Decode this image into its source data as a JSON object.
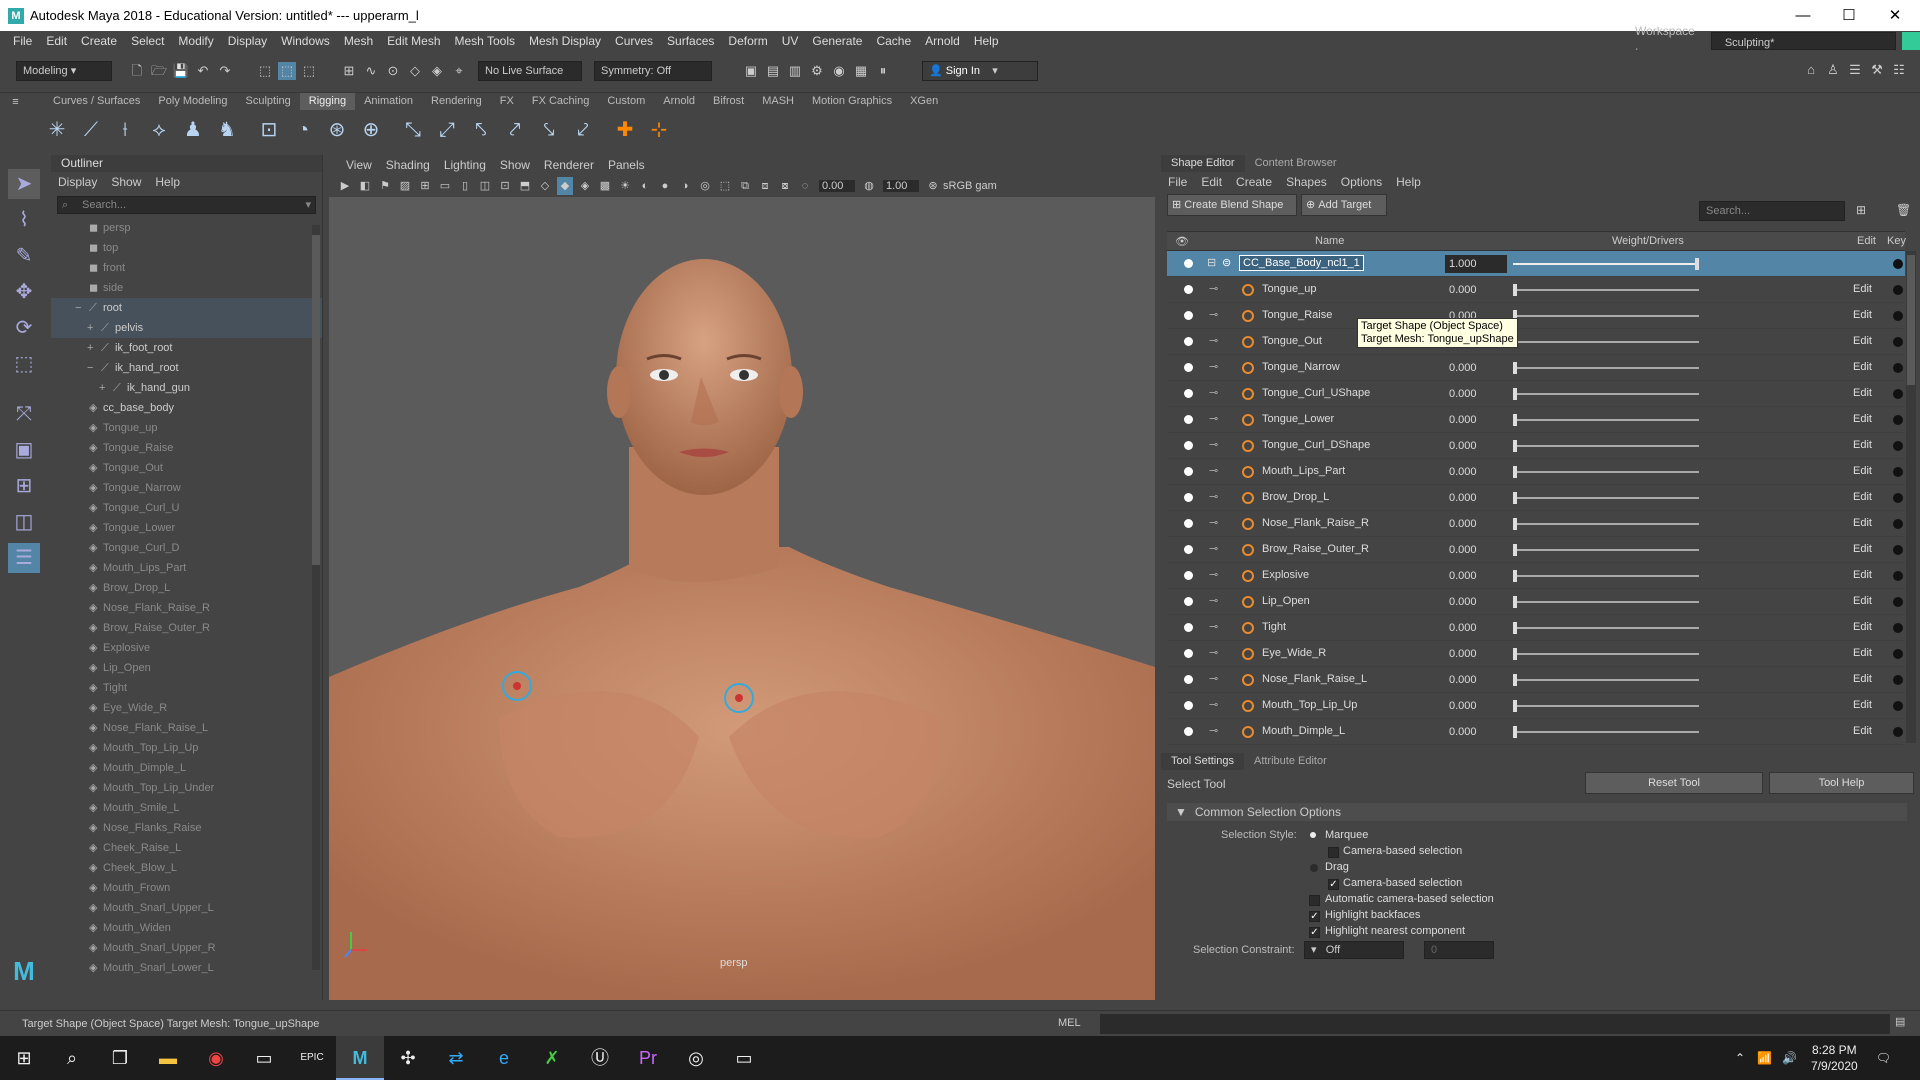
{
  "window": {
    "title": "Autodesk Maya 2018 - Educational Version: untitled*  ---  upperarm_l"
  },
  "menubar": [
    "File",
    "Edit",
    "Create",
    "Select",
    "Modify",
    "Display",
    "Windows",
    "Mesh",
    "Edit Mesh",
    "Mesh Tools",
    "Mesh Display",
    "Curves",
    "Surfaces",
    "Deform",
    "UV",
    "Generate",
    "Cache",
    "Arnold",
    "Help"
  ],
  "workspace": {
    "label": "Workspace :",
    "value": "Sculpting*"
  },
  "status": {
    "mode": "Modeling",
    "live_surface": "No Live Surface",
    "symmetry": "Symmetry: Off",
    "sign_in": "Sign In"
  },
  "shelf_tabs": [
    "Curves / Surfaces",
    "Poly Modeling",
    "Sculpting",
    "Rigging",
    "Animation",
    "Rendering",
    "FX",
    "FX Caching",
    "Custom",
    "Arnold",
    "Bifrost",
    "MASH",
    "Motion Graphics",
    "XGen"
  ],
  "shelf_active": "Rigging",
  "outliner": {
    "title": "Outliner",
    "menu": [
      "Display",
      "Show",
      "Help"
    ],
    "search_placeholder": "Search...",
    "items": [
      {
        "label": "persp",
        "indent": 1,
        "dim": true,
        "icon": "camera-icon"
      },
      {
        "label": "top",
        "indent": 1,
        "dim": true,
        "icon": "camera-icon"
      },
      {
        "label": "front",
        "indent": 1,
        "dim": true,
        "icon": "camera-icon"
      },
      {
        "label": "side",
        "indent": 1,
        "dim": true,
        "icon": "camera-icon"
      },
      {
        "label": "root",
        "indent": 1,
        "dim": false,
        "icon": "joint-icon",
        "sel": true,
        "exp": "−"
      },
      {
        "label": "pelvis",
        "indent": 2,
        "dim": false,
        "icon": "joint-icon",
        "sel": true,
        "exp": "+"
      },
      {
        "label": "ik_foot_root",
        "indent": 2,
        "dim": false,
        "icon": "joint-icon",
        "exp": "+"
      },
      {
        "label": "ik_hand_root",
        "indent": 2,
        "dim": false,
        "icon": "joint-icon",
        "exp": "−"
      },
      {
        "label": "ik_hand_gun",
        "indent": 3,
        "dim": false,
        "icon": "joint-icon",
        "exp": "+"
      },
      {
        "label": "cc_base_body",
        "indent": 1,
        "dim": false,
        "icon": "mesh-icon"
      },
      {
        "label": "Tongue_up",
        "indent": 1,
        "dim": true,
        "icon": "mesh-icon"
      },
      {
        "label": "Tongue_Raise",
        "indent": 1,
        "dim": true,
        "icon": "mesh-icon"
      },
      {
        "label": "Tongue_Out",
        "indent": 1,
        "dim": true,
        "icon": "mesh-icon"
      },
      {
        "label": "Tongue_Narrow",
        "indent": 1,
        "dim": true,
        "icon": "mesh-icon"
      },
      {
        "label": "Tongue_Curl_U",
        "indent": 1,
        "dim": true,
        "icon": "mesh-icon"
      },
      {
        "label": "Tongue_Lower",
        "indent": 1,
        "dim": true,
        "icon": "mesh-icon"
      },
      {
        "label": "Tongue_Curl_D",
        "indent": 1,
        "dim": true,
        "icon": "mesh-icon"
      },
      {
        "label": "Mouth_Lips_Part",
        "indent": 1,
        "dim": true,
        "icon": "mesh-icon"
      },
      {
        "label": "Brow_Drop_L",
        "indent": 1,
        "dim": true,
        "icon": "mesh-icon"
      },
      {
        "label": "Nose_Flank_Raise_R",
        "indent": 1,
        "dim": true,
        "icon": "mesh-icon"
      },
      {
        "label": "Brow_Raise_Outer_R",
        "indent": 1,
        "dim": true,
        "icon": "mesh-icon"
      },
      {
        "label": "Explosive",
        "indent": 1,
        "dim": true,
        "icon": "mesh-icon"
      },
      {
        "label": "Lip_Open",
        "indent": 1,
        "dim": true,
        "icon": "mesh-icon"
      },
      {
        "label": "Tight",
        "indent": 1,
        "dim": true,
        "icon": "mesh-icon"
      },
      {
        "label": "Eye_Wide_R",
        "indent": 1,
        "dim": true,
        "icon": "mesh-icon"
      },
      {
        "label": "Nose_Flank_Raise_L",
        "indent": 1,
        "dim": true,
        "icon": "mesh-icon"
      },
      {
        "label": "Mouth_Top_Lip_Up",
        "indent": 1,
        "dim": true,
        "icon": "mesh-icon"
      },
      {
        "label": "Mouth_Dimple_L",
        "indent": 1,
        "dim": true,
        "icon": "mesh-icon"
      },
      {
        "label": "Mouth_Top_Lip_Under",
        "indent": 1,
        "dim": true,
        "icon": "mesh-icon"
      },
      {
        "label": "Mouth_Smile_L",
        "indent": 1,
        "dim": true,
        "icon": "mesh-icon"
      },
      {
        "label": "Nose_Flanks_Raise",
        "indent": 1,
        "dim": true,
        "icon": "mesh-icon"
      },
      {
        "label": "Cheek_Raise_L",
        "indent": 1,
        "dim": true,
        "icon": "mesh-icon"
      },
      {
        "label": "Cheek_Blow_L",
        "indent": 1,
        "dim": true,
        "icon": "mesh-icon"
      },
      {
        "label": "Mouth_Frown",
        "indent": 1,
        "dim": true,
        "icon": "mesh-icon"
      },
      {
        "label": "Mouth_Snarl_Upper_L",
        "indent": 1,
        "dim": true,
        "icon": "mesh-icon"
      },
      {
        "label": "Mouth_Widen",
        "indent": 1,
        "dim": true,
        "icon": "mesh-icon"
      },
      {
        "label": "Mouth_Snarl_Upper_R",
        "indent": 1,
        "dim": true,
        "icon": "mesh-icon"
      },
      {
        "label": "Mouth_Snarl_Lower_L",
        "indent": 1,
        "dim": true,
        "icon": "mesh-icon"
      }
    ]
  },
  "viewport": {
    "menu": [
      "View",
      "Shading",
      "Lighting",
      "Show",
      "Renderer",
      "Panels"
    ],
    "field1": "0.00",
    "field2": "1.00",
    "colorspace": "sRGB gam",
    "camera_label": "persp"
  },
  "shape_editor": {
    "tabs": [
      "Shape Editor",
      "Content Browser"
    ],
    "menu": [
      "File",
      "Edit",
      "Create",
      "Shapes",
      "Options",
      "Help"
    ],
    "create_blend": "Create Blend Shape",
    "add_target": "Add Target",
    "search_placeholder": "Search...",
    "col_name": "Name",
    "col_weight": "Weight/Drivers",
    "col_edit": "Edit",
    "col_key": "Key",
    "edit_label": "Edit",
    "blend_node": {
      "name": "CC_Base_Body_ncl1_1",
      "value": "1.000",
      "weight": 1.0
    },
    "targets": [
      {
        "name": "Tongue_up",
        "value": "0.000"
      },
      {
        "name": "Tongue_Raise",
        "value": "0.000"
      },
      {
        "name": "Tongue_Out",
        "value": "0.000"
      },
      {
        "name": "Tongue_Narrow",
        "value": "0.000"
      },
      {
        "name": "Tongue_Curl_UShape",
        "value": "0.000"
      },
      {
        "name": "Tongue_Lower",
        "value": "0.000"
      },
      {
        "name": "Tongue_Curl_DShape",
        "value": "0.000"
      },
      {
        "name": "Mouth_Lips_Part",
        "value": "0.000"
      },
      {
        "name": "Brow_Drop_L",
        "value": "0.000"
      },
      {
        "name": "Nose_Flank_Raise_R",
        "value": "0.000"
      },
      {
        "name": "Brow_Raise_Outer_R",
        "value": "0.000"
      },
      {
        "name": "Explosive",
        "value": "0.000"
      },
      {
        "name": "Lip_Open",
        "value": "0.000"
      },
      {
        "name": "Tight",
        "value": "0.000"
      },
      {
        "name": "Eye_Wide_R",
        "value": "0.000"
      },
      {
        "name": "Nose_Flank_Raise_L",
        "value": "0.000"
      },
      {
        "name": "Mouth_Top_Lip_Up",
        "value": "0.000"
      },
      {
        "name": "Mouth_Dimple_L",
        "value": "0.000"
      }
    ],
    "tooltip_line1": "Target Shape (Object Space)",
    "tooltip_line2": "Target Mesh: Tongue_upShape"
  },
  "tool_settings": {
    "tabs": [
      "Tool Settings",
      "Attribute Editor"
    ],
    "tool_name": "Select Tool",
    "reset": "Reset Tool",
    "help": "Tool Help",
    "section": "Common Selection Options",
    "style_label": "Selection Style:",
    "marquee": "Marquee",
    "camera_based": "Camera-based selection",
    "drag": "Drag",
    "camera_based2": "Camera-based selection",
    "auto_camera": "Automatic camera-based selection",
    "highlight_backfaces": "Highlight backfaces",
    "highlight_nearest": "Highlight nearest component",
    "constraint_label": "Selection Constraint:",
    "constraint_value": "Off",
    "constraint_num": "0"
  },
  "helpline": {
    "text": "Target Shape (Object Space) Target Mesh: Tongue_upShape",
    "mel": "MEL"
  },
  "taskbar": {
    "time": "8:28 PM",
    "date": "7/9/2020"
  },
  "colors": {
    "accent": "#5285a6",
    "skin": "#c48a68",
    "target_icon": "#e88a2d"
  }
}
